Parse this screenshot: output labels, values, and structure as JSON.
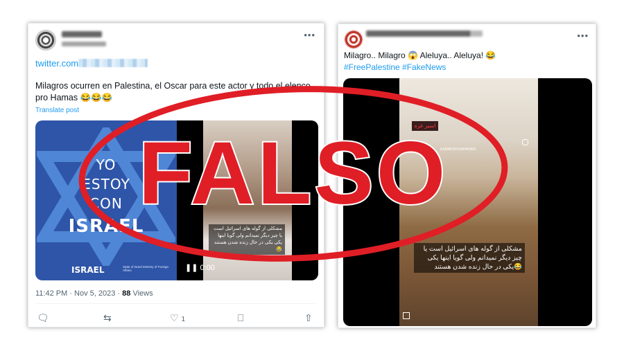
{
  "left_tweet": {
    "link": "twitter.com/",
    "text": "Milagros ocurren en Palestina, el Oscar para este actor y todo el elenco pro Hamas 😂😂😂",
    "translate": "Translate post",
    "image": {
      "line1": "YO",
      "line2": "ESTOY",
      "line3": "CON",
      "line4": "ISRAEL",
      "footer_logo": "ISRAEL",
      "footer_small": "State of Israel Ministry of Foreign Affairs"
    },
    "video": {
      "overlay_text": "مشکلی از گوله های اسرائیل است یا چیز دیگر نمیدانم ولی گویا اینها یکی یکی در حال زنده شدن هستند😂",
      "time": "0:00"
    },
    "timestamp": "11:42 PM · Nov 5, 2023 · ",
    "views_count": "88",
    "views_label": "Views",
    "like_count": "1"
  },
  "right_tweet": {
    "text": "Milagro.. Milagro 😱 Aleluya.. Aleluya! 😂",
    "hashtags": "#FreePalestine #FakeNews",
    "video": {
      "sign": "اسیر غزه",
      "handle": "EAMARSHUAIHANMO",
      "overlay_text": "مشکلی از گوله های اسرائیل است یا چیز دیگر نمیدانم ولی گویا اینها یکی یکی در حال زنده شدن هستند😂"
    }
  },
  "stamp": {
    "label": "FALSO",
    "color": "#e01e26"
  },
  "colors": {
    "link": "#1d9bf0",
    "israel_blue": "#2e55a8",
    "muted": "#536471"
  }
}
